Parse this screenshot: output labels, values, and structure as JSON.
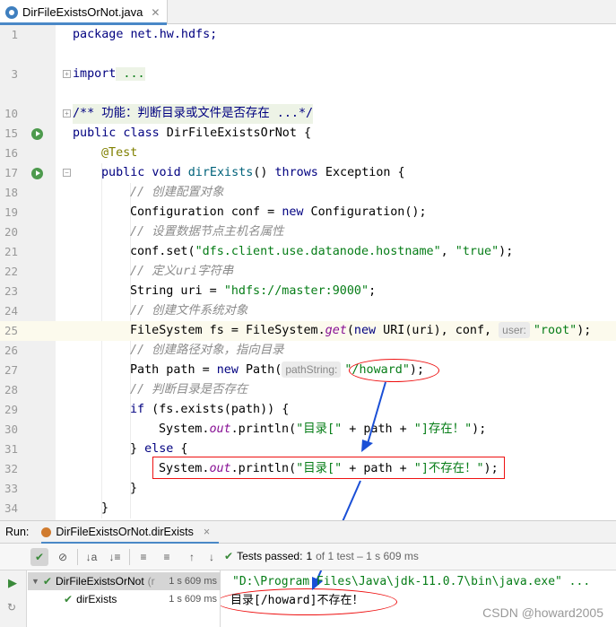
{
  "tab": {
    "title": "DirFileExistsOrNot.java",
    "close": "✕"
  },
  "code": {
    "l1": {
      "num": "1",
      "t": [
        "package net.hw.hdfs;"
      ]
    },
    "l3": {
      "num": "3",
      "t": [
        "import",
        " ..."
      ]
    },
    "l10": {
      "num": "10",
      "t": [
        "/** 功能：判断目录或文件是否存在 ...*/"
      ]
    },
    "l15": {
      "num": "15",
      "t": [
        "public class",
        " DirFileExistsOrNot {"
      ]
    },
    "l16": {
      "num": "16",
      "t": [
        "@Test"
      ]
    },
    "l17": {
      "num": "17",
      "t": [
        "public void",
        " dirExists",
        "() ",
        "throws",
        " Exception {"
      ]
    },
    "l18": {
      "num": "18",
      "t": [
        "// 创建配置对象"
      ]
    },
    "l19": {
      "num": "19",
      "t": [
        "Configuration conf = ",
        "new",
        " Configuration();"
      ]
    },
    "l20": {
      "num": "20",
      "t": [
        "// 设置数据节点主机名属性"
      ]
    },
    "l21": {
      "num": "21",
      "t": [
        "conf.set(",
        "\"dfs.client.use.datanode.hostname\"",
        ", ",
        "\"true\"",
        ");"
      ]
    },
    "l22": {
      "num": "22",
      "t": [
        "// 定义uri字符串"
      ]
    },
    "l23": {
      "num": "23",
      "t": [
        "String uri = ",
        "\"hdfs://master:9000\"",
        ";"
      ]
    },
    "l24": {
      "num": "24",
      "t": [
        "// 创建文件系统对象"
      ]
    },
    "l25": {
      "num": "25",
      "t": [
        "FileSystem fs = FileSystem.",
        "get",
        "(",
        "new",
        " URI(uri), conf, ",
        "user:",
        "\"root\"",
        ");"
      ]
    },
    "l26": {
      "num": "26",
      "t": [
        "// 创建路径对象，指向目录"
      ]
    },
    "l27": {
      "num": "27",
      "t": [
        "Path path = ",
        "new",
        " Path(",
        "pathString:",
        "\"/howard\"",
        ");"
      ]
    },
    "l28": {
      "num": "28",
      "t": [
        "// 判断目录是否存在"
      ]
    },
    "l29": {
      "num": "29",
      "t": [
        "if",
        " (fs.exists(path)) {"
      ]
    },
    "l30": {
      "num": "30",
      "t": [
        "System.",
        "out",
        ".println(",
        "\"目录[\"",
        " + path + ",
        "\"]存在！\"",
        ");"
      ]
    },
    "l31": {
      "num": "31",
      "t": [
        "} ",
        "else",
        " {"
      ]
    },
    "l32": {
      "num": "32",
      "t": [
        "System.",
        "out",
        ".println(",
        "\"目录[\"",
        " + path + ",
        "\"]不存在！\"",
        ");"
      ]
    },
    "l33": {
      "num": "33",
      "t": [
        "}"
      ]
    },
    "l34": {
      "num": "34",
      "t": [
        "}"
      ]
    }
  },
  "run": {
    "label": "Run:",
    "config": "DirFileExistsOrNot.dirExists",
    "close": "×",
    "status": {
      "prefix": "Tests passed:",
      "count": "1",
      "detail": "of 1 test – 1 s 609 ms"
    },
    "tree": [
      {
        "name": "DirFileExistsOrNot",
        "suffix": "(r",
        "time": "1 s 609 ms"
      },
      {
        "name": "dirExists",
        "time": "1 s 609 ms"
      }
    ],
    "console": [
      "\"D:\\Program Files\\Java\\jdk-11.0.7\\bin\\java.exe\" ...",
      "目录[/howard]不存在！"
    ]
  },
  "watermark": "CSDN @howard2005"
}
